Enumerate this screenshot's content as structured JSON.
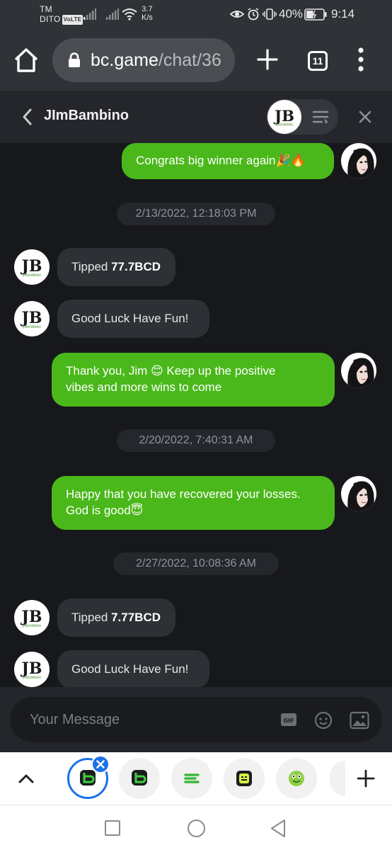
{
  "status_bar": {
    "carrier_line1": "TM",
    "carrier_line2": "DITO",
    "volte": "VoLTE",
    "net_speed_value": "3.7",
    "net_speed_unit": "K/s",
    "battery": "40%",
    "time": "9:14"
  },
  "browser": {
    "url_host": "bc.game",
    "url_path": "/chat/36",
    "tab_count": "11"
  },
  "chat": {
    "title": "JImBambino",
    "input_placeholder": "Your Message",
    "gif_label": "GIF"
  },
  "messages": [
    {
      "type": "out",
      "text": "Congrats big winner again🎉🔥"
    },
    {
      "type": "stamp",
      "text": "2/13/2022, 12:18:03 PM"
    },
    {
      "type": "in",
      "prefix": "Tipped ",
      "amount": "77.7BCD"
    },
    {
      "type": "in",
      "text": "Good Luck Have Fun!"
    },
    {
      "type": "out",
      "line1": "Thank you, Jim 😊 Keep up the positive",
      "line2": "vibes and more wins to come"
    },
    {
      "type": "stamp",
      "text": "2/20/2022, 7:40:31 AM"
    },
    {
      "type": "out",
      "line1": "Happy that you have recovered your losses.",
      "line2": "God is good😇"
    },
    {
      "type": "stamp",
      "text": "2/27/2022, 10:08:36 AM"
    },
    {
      "type": "in",
      "prefix": "Tipped ",
      "amount": "7.77BCD"
    },
    {
      "type": "in",
      "text": "Good Luck Have Fun!"
    }
  ],
  "avatar_logo_text": "JB",
  "avatar_logo_subtext": "JIMBAMBINO",
  "colors": {
    "accent_green": "#4ab81a",
    "dark_bg": "#17181b",
    "active_tab_blue": "#1a73e8"
  }
}
